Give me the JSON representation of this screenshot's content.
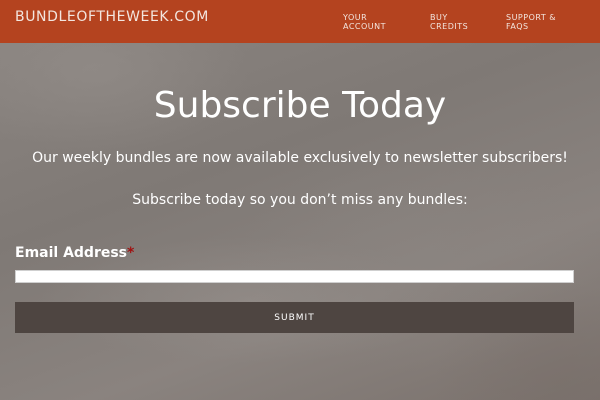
{
  "header": {
    "site_title": "BUNDLEOFTHEWEEK.COM",
    "nav": [
      {
        "label": "YOUR\nACCOUNT"
      },
      {
        "label": "BUY\nCREDITS"
      },
      {
        "label": "SUPPORT &\nFAQS"
      }
    ]
  },
  "main": {
    "title": "Subscribe Today",
    "lead_1": "Our weekly bundles are now available exclusively to newsletter subscribers!",
    "lead_2": "Subscribe today so you don’t miss any bundles:"
  },
  "form": {
    "email_label": "Email Address",
    "required_mark": "*",
    "email_value": "",
    "submit_label": "SUBMIT"
  },
  "colors": {
    "header_bg": "#b4431f",
    "button_bg": "#4e4541",
    "required": "#a01010"
  }
}
